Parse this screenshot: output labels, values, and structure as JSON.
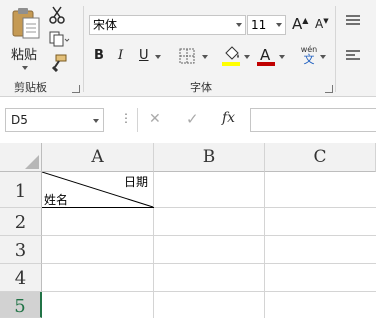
{
  "ribbon": {
    "clipboard": {
      "paste_label": "粘贴",
      "group_label": "剪贴板"
    },
    "font": {
      "font_name": "宋体",
      "font_size": "11",
      "bold": "B",
      "italic": "I",
      "underline": "U",
      "grow": "A",
      "shrink": "A",
      "font_color_label": "A",
      "phonetic_top": "wén",
      "phonetic_bottom": "文",
      "group_label": "字体",
      "font_color_hex": "#c00000",
      "fill_color_hex": "#ffff00"
    }
  },
  "formula_bar": {
    "name_box": "D5",
    "cancel_icon": "✕",
    "enter_icon": "✓",
    "fx_label": "fx",
    "value": ""
  },
  "sheet": {
    "columns": [
      "A",
      "B",
      "C"
    ],
    "rows": [
      "1",
      "2",
      "3",
      "4",
      "5"
    ],
    "active_cell": "D5",
    "cell_A1": {
      "top_right": "日期",
      "bottom_left": "姓名"
    }
  },
  "colors": {
    "accent_green": "#217346",
    "ribbon_bg": "#f3f3f3",
    "header_bg": "#f2f2f2"
  }
}
